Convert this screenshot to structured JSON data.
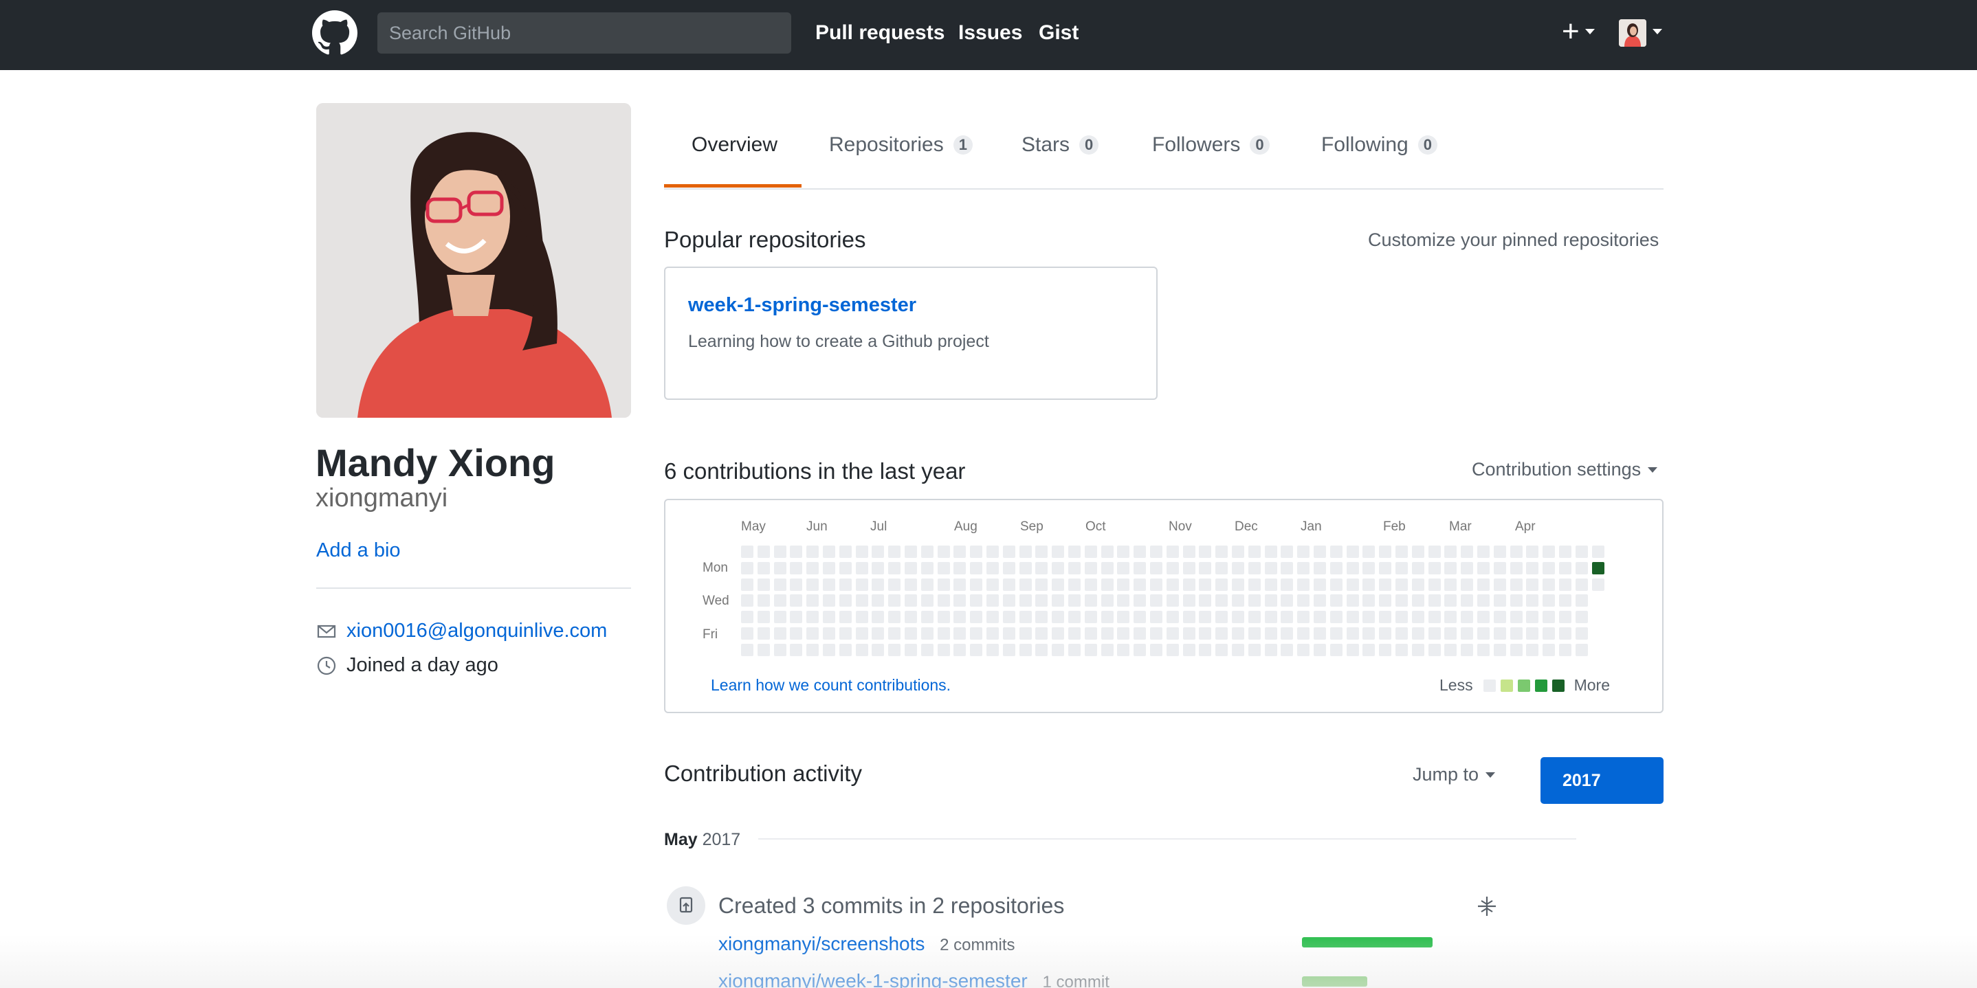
{
  "header": {
    "search_placeholder": "Search GitHub",
    "nav": [
      "Pull requests",
      "Issues",
      "Gist"
    ],
    "plus_label": "+"
  },
  "profile": {
    "full_name": "Mandy Xiong",
    "username": "xiongmanyi",
    "add_bio": "Add a bio",
    "email": "xion0016@algonquinlive.com",
    "joined": "Joined a day ago"
  },
  "tabs": [
    {
      "label": "Overview",
      "count": null,
      "selected": true
    },
    {
      "label": "Repositories",
      "count": "1"
    },
    {
      "label": "Stars",
      "count": "0"
    },
    {
      "label": "Followers",
      "count": "0"
    },
    {
      "label": "Following",
      "count": "0"
    }
  ],
  "popular": {
    "title": "Popular repositories",
    "customize": "Customize your pinned repositories",
    "repo_name": "week-1-spring-semester",
    "repo_desc": "Learning how to create a Github project"
  },
  "contributions": {
    "title": "6 contributions in the last year",
    "settings": "Contribution settings",
    "months": [
      "May",
      "Jun",
      "Jul",
      "Aug",
      "Sep",
      "Oct",
      "Nov",
      "Dec",
      "Jan",
      "Feb",
      "Mar",
      "Apr"
    ],
    "days": [
      "Mon",
      "Wed",
      "Fri"
    ],
    "learn": "Learn how we count contributions.",
    "less": "Less",
    "more": "More",
    "legend_colors": [
      "#ebedf0",
      "#c6e48b",
      "#7bc96f",
      "#239a3b",
      "#196127"
    ],
    "active_cell_color": "#196127"
  },
  "activity": {
    "title": "Contribution activity",
    "jump_to": "Jump to",
    "year_button": "2017",
    "month": "May",
    "month_year": "2017",
    "summary": "Created 3 commits in 2 repositories",
    "rows": [
      {
        "repo": "xiongmanyi/screenshots",
        "commits": "2 commits",
        "share": 1.0
      },
      {
        "repo": "xiongmanyi/week-1-spring-semester",
        "commits": "1 commit",
        "share": 0.5
      }
    ]
  },
  "colors": {
    "header_bg": "#24292e",
    "link": "#0366d6",
    "tab_accent": "#e36209"
  }
}
